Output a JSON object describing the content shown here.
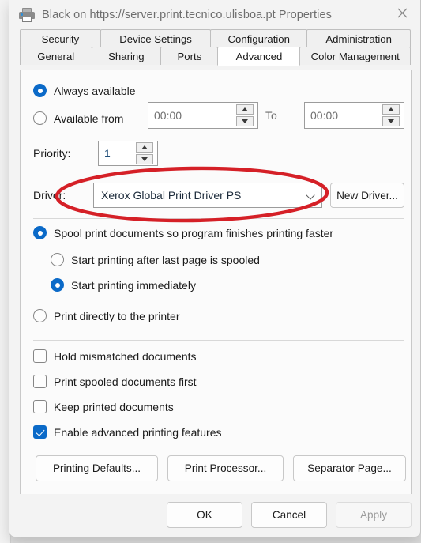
{
  "window": {
    "title": "Black on https://server.print.tecnico.ulisboa.pt Properties",
    "icon": "printer-icon",
    "close_label": "×"
  },
  "tabs": {
    "row1": [
      {
        "label": "Security",
        "selected": false
      },
      {
        "label": "Device Settings",
        "selected": false
      },
      {
        "label": "Configuration",
        "selected": false
      },
      {
        "label": "Administration",
        "selected": false
      }
    ],
    "row2": [
      {
        "label": "General",
        "selected": false
      },
      {
        "label": "Sharing",
        "selected": false
      },
      {
        "label": "Ports",
        "selected": false
      },
      {
        "label": "Advanced",
        "selected": true
      },
      {
        "label": "Color Management",
        "selected": false
      }
    ]
  },
  "availability": {
    "always_available_label": "Always available",
    "always_available_checked": true,
    "available_from_label": "Available from",
    "available_from_checked": false,
    "from_time": "00:00",
    "to_label": "To",
    "to_time": "00:00"
  },
  "priority": {
    "label": "Priority:",
    "value": "1"
  },
  "driver": {
    "label": "Driver:",
    "selected": "Xerox Global Print Driver PS",
    "new_driver_button": "New Driver..."
  },
  "spooling": {
    "spool_label": "Spool print documents so program finishes printing faster",
    "spool_checked": true,
    "after_last_page_label": "Start printing after last page is spooled",
    "after_last_page_checked": false,
    "immediately_label": "Start printing immediately",
    "immediately_checked": true,
    "direct_label": "Print directly to the printer",
    "direct_checked": false
  },
  "options": [
    {
      "label": "Hold mismatched documents",
      "checked": false
    },
    {
      "label": "Print spooled documents first",
      "checked": false
    },
    {
      "label": "Keep printed documents",
      "checked": false
    },
    {
      "label": "Enable advanced printing features",
      "checked": true
    }
  ],
  "action_buttons": {
    "printing_defaults": "Printing Defaults...",
    "print_processor": "Print Processor...",
    "separator_page": "Separator Page..."
  },
  "footer": {
    "ok": "OK",
    "cancel": "Cancel",
    "apply": "Apply",
    "apply_disabled": true
  },
  "annotation": {
    "shape": "ellipse",
    "color": "#d52027",
    "target": "Driver row"
  },
  "colors": {
    "accent": "#0b6ac8",
    "annotation_red": "#d52027",
    "dialog_bg": "#f3f3f3",
    "panel_bg": "#fbfbfb",
    "title_text": "#6e6e6e"
  }
}
